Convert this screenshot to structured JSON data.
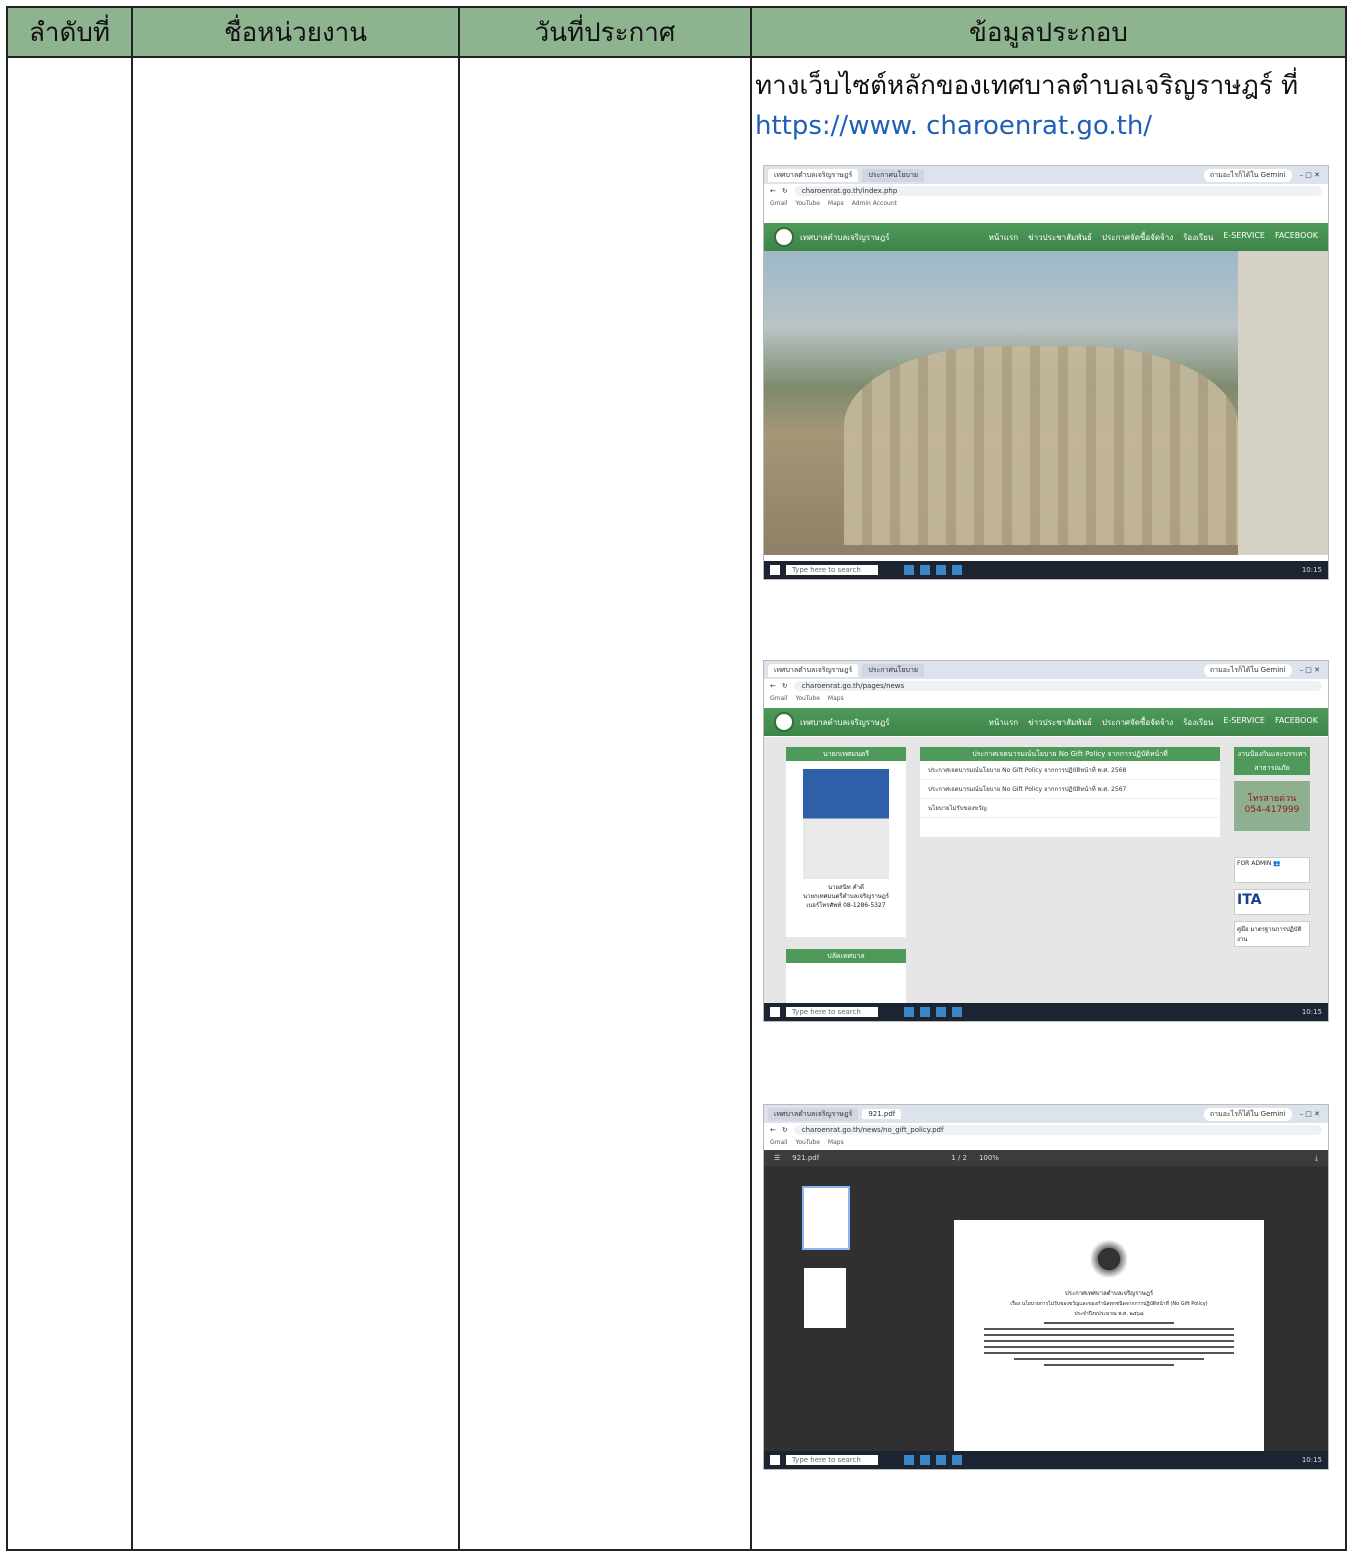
{
  "table": {
    "headers": [
      "ลำดับที่",
      "ชื่อหน่วยงาน",
      "วันที่ประกาศ",
      "ข้อมูลประกอบ"
    ]
  },
  "info": {
    "line1": "ทางเว็บไซต์หลักของเทศบาลตำบลเจริญราษฎร์ ที่",
    "url": "https://www. charoenrat.go.th/"
  },
  "browser": {
    "tab_active": "เทศบาลตำบลเจริญราษฎร์",
    "tab_2": "ประกาศนโยบาย",
    "gemini": "ถามอะไรก็ได้ใน Gemini",
    "url_home": "charoenrat.go.th/index.php",
    "url_news": "charoenrat.go.th/pages/news",
    "url_pdf": "charoenrat.go.th/news/no_gift_policy.pdf",
    "bookmarks": [
      "Gmail",
      "YouTube",
      "Maps",
      "Admin Account"
    ],
    "search_placeholder": "Type here to search",
    "clock": "10:15"
  },
  "site": {
    "name": "เทศบาลตำบลเจริญราษฎร์",
    "nav": [
      "หน้าแรก",
      "ข่าวประชาสัมพันธ์",
      "ประกาศจัดซื้อจัดจ้าง",
      "ร้องเรียน",
      "E-SERVICE",
      "FACEBOOK"
    ],
    "mayor_head": "นายกเทศมนตรี",
    "mayor_caption": [
      "นายสนิท คำดี",
      "นายกเทศมนตรีตำบลเจริญราษฎร์",
      "เบอร์โทรศัพท์ 08-1286-5327"
    ],
    "clerk_head": "ปลัดเทศบาล",
    "notice_title": "ประกาศเจตนารมณ์นโยบาย No Gift Policy จากการปฏิบัติหน้าที่",
    "notices": [
      "ประกาศเจตนารมณ์นโยบาย No Gift Policy จากการปฏิบัติหน้าที่ พ.ศ. 2568",
      "ประกาศเจตนารมณ์นโยบาย No Gift Policy จากการปฏิบัติหน้าที่ พ.ศ. 2567",
      "นโยบายไม่รับของขวัญ"
    ],
    "side_head": "งานป้องกันและบรรเทาสาธารณภัย",
    "contact_label": "โทรสายด่วน",
    "contact_phone": "054-417999",
    "admin": "FOR ADMIN",
    "ita": "ITA",
    "manual": "คู่มือ มาตรฐานการปฏิบัติงาน"
  },
  "pdf": {
    "filename": "921.pdf",
    "page_info": "1 / 2",
    "zoom": "100%",
    "doc_title": "ประกาศเทศบาลตำบลเจริญราษฎร์",
    "doc_subject": "เรื่อง นโยบายการไม่รับของขวัญและของกำนัลทุกชนิดจากการปฏิบัติหน้าที่ (No Gift Policy)",
    "doc_year": "ประจำปีงบประมาณ พ.ศ. ๒๕๖๘"
  }
}
